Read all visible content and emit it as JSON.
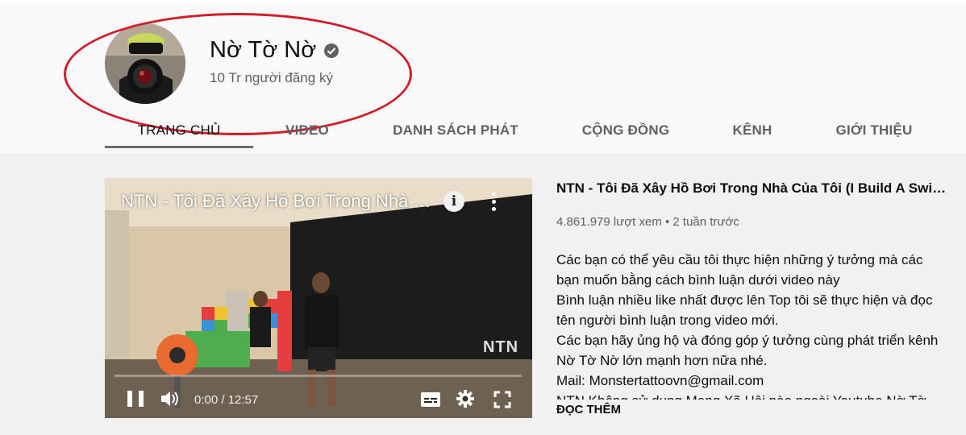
{
  "channel": {
    "name": "Nờ Tờ Nờ",
    "subscribers": "10 Tr người đăng ký",
    "verified": true
  },
  "tabs": [
    {
      "label": "TRANG CHỦ",
      "active": true
    },
    {
      "label": "VIDEO",
      "active": false
    },
    {
      "label": "DANH SÁCH PHÁT",
      "active": false
    },
    {
      "label": "CỘNG ĐỒNG",
      "active": false
    },
    {
      "label": "KÊNH",
      "active": false
    },
    {
      "label": "GIỚI THIỆU",
      "active": false
    }
  ],
  "player": {
    "overlay_title": "NTN - Tôi Đã Xây Hồ Bơi Trong Nhà C...",
    "info_glyph": "i",
    "time": "0:00 / 12:57",
    "watermark": "NTN",
    "progress": 0
  },
  "featured_video": {
    "title": "NTN - Tôi Đã Xây Hồ Bơi Trong Nhà Của Tôi (I Build A Swim...",
    "views": "4.861.979 lượt xem",
    "separator": "•",
    "age": "2 tuần trước",
    "description_lines": [
      "Các bạn có thể yêu cầu tôi thực hiện những ý tưởng mà các",
      "bạn muốn bằng cách bình luận dưới video này",
      "Bình luận nhiều like nhất được lên Top tôi sẽ thực hiện và đọc",
      "tên người bình luận trong video mới.",
      "Các bạn hãy ủng hộ và đóng góp ý tưởng cùng phát triển kênh",
      "Nờ Tờ Nờ lớn mạnh hơn nữa nhé.",
      "Mail: Monstertattoovn@gmail.com",
      "NTN Không sử dụng Mạng Xã Hội nào ngoài Youtube Nờ Tờ"
    ],
    "read_more": "ĐỌC THÊM"
  },
  "colors": {
    "annotation_ellipse": "#d11e2d",
    "header_bg": "#f9f9f9",
    "page_bg": "#f1f1f1"
  }
}
